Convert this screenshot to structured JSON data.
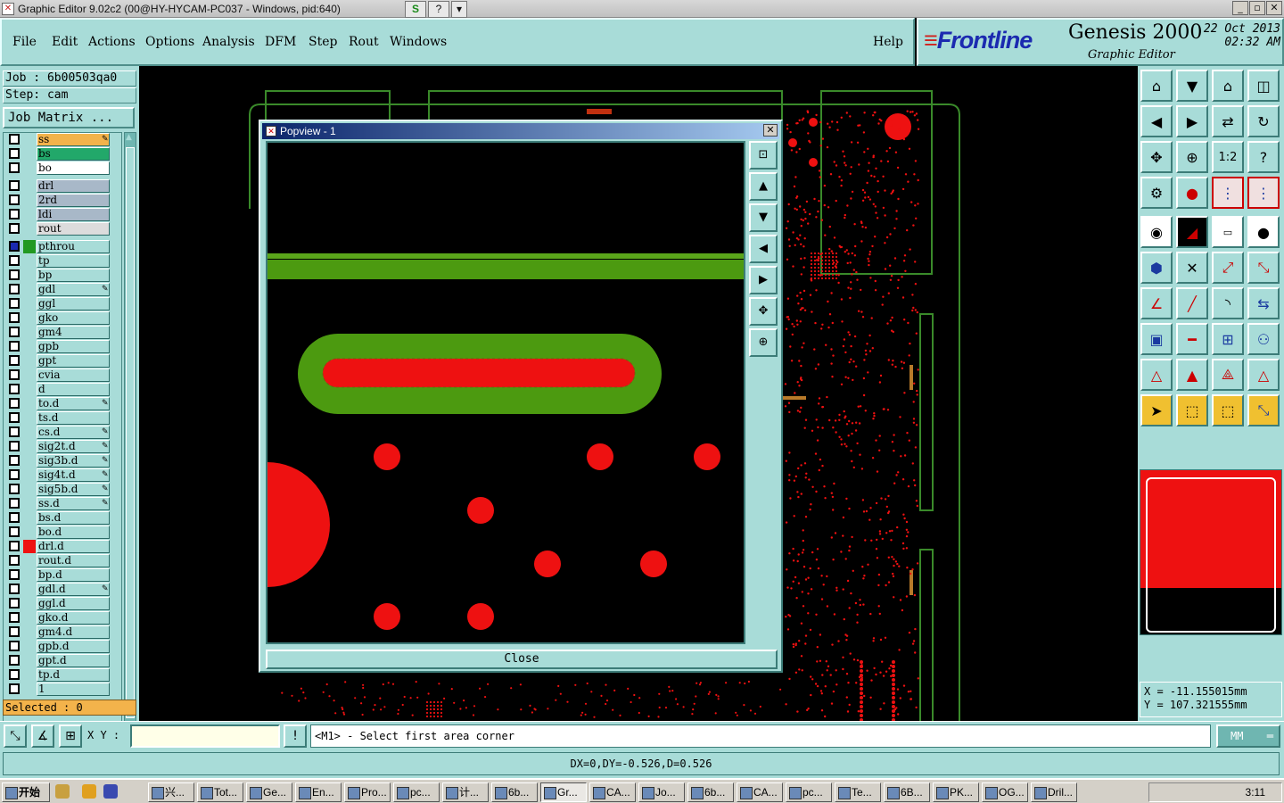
{
  "window": {
    "title": "Graphic Editor 9.02c2 (00@HY-HYCAM-PC037 - Windows, pid:640)",
    "controls": [
      "_",
      "▫",
      "✕"
    ]
  },
  "menu": {
    "items": [
      "File",
      "Edit",
      "Actions",
      "Options",
      "Analysis",
      "DFM",
      "Step",
      "Rout",
      "Windows"
    ],
    "help": "Help"
  },
  "brand": {
    "logo": "Frontline",
    "product": "Genesis 2000",
    "subtitle": "Graphic Editor",
    "date": "22 Oct 2013",
    "time": "02:32 AM"
  },
  "job": {
    "job_line": "Job : 6b00503qa0",
    "step_line": "Step: cam",
    "matrix_button": "Job Matrix ..."
  },
  "layers": [
    {
      "name": "ss",
      "bg": "#f3b34b",
      "edit": true
    },
    {
      "name": "bs",
      "bg": "#22a86a"
    },
    {
      "name": "bo",
      "bg": "#ffffff"
    },
    {
      "name": "drl",
      "bg": "#a8b8c8",
      "gap": true
    },
    {
      "name": "2rd",
      "bg": "#a8b8c8"
    },
    {
      "name": "ldi",
      "bg": "#a8b8c8"
    },
    {
      "name": "rout",
      "bg": "#dcdcdc"
    },
    {
      "name": "pthrou",
      "bg": "#a8dcd8",
      "gap": true,
      "color": "#229922",
      "active": true
    },
    {
      "name": "tp",
      "bg": "#a8dcd8"
    },
    {
      "name": "bp",
      "bg": "#a8dcd8"
    },
    {
      "name": "gdl",
      "bg": "#a8dcd8",
      "edit": true
    },
    {
      "name": "ggl",
      "bg": "#a8dcd8"
    },
    {
      "name": "gko",
      "bg": "#a8dcd8"
    },
    {
      "name": "gm4",
      "bg": "#a8dcd8"
    },
    {
      "name": "gpb",
      "bg": "#a8dcd8"
    },
    {
      "name": "gpt",
      "bg": "#a8dcd8"
    },
    {
      "name": "cvia",
      "bg": "#a8dcd8"
    },
    {
      "name": "d",
      "bg": "#a8dcd8"
    },
    {
      "name": "to.d",
      "bg": "#a8dcd8",
      "edit": true
    },
    {
      "name": "ts.d",
      "bg": "#a8dcd8"
    },
    {
      "name": "cs.d",
      "bg": "#a8dcd8",
      "edit": true
    },
    {
      "name": "sig2t.d",
      "bg": "#a8dcd8",
      "edit": true
    },
    {
      "name": "sig3b.d",
      "bg": "#a8dcd8",
      "edit": true
    },
    {
      "name": "sig4t.d",
      "bg": "#a8dcd8",
      "edit": true
    },
    {
      "name": "sig5b.d",
      "bg": "#a8dcd8",
      "edit": true
    },
    {
      "name": "ss.d",
      "bg": "#a8dcd8",
      "edit": true
    },
    {
      "name": "bs.d",
      "bg": "#a8dcd8"
    },
    {
      "name": "bo.d",
      "bg": "#a8dcd8"
    },
    {
      "name": "drl.d",
      "bg": "#a8dcd8",
      "color": "#ee1111"
    },
    {
      "name": "rout.d",
      "bg": "#a8dcd8"
    },
    {
      "name": "bp.d",
      "bg": "#a8dcd8"
    },
    {
      "name": "gdl.d",
      "bg": "#a8dcd8",
      "edit": true
    },
    {
      "name": "ggl.d",
      "bg": "#a8dcd8"
    },
    {
      "name": "gko.d",
      "bg": "#a8dcd8"
    },
    {
      "name": "gm4.d",
      "bg": "#a8dcd8"
    },
    {
      "name": "gpb.d",
      "bg": "#a8dcd8"
    },
    {
      "name": "gpt.d",
      "bg": "#a8dcd8"
    },
    {
      "name": "tp.d",
      "bg": "#a8dcd8"
    },
    {
      "name": "1",
      "bg": "#a8dcd8"
    }
  ],
  "selected": "Selected : 0",
  "popview": {
    "title": "Popview - 1",
    "close": "Close"
  },
  "coords": {
    "x": "X = -11.155015mm",
    "y": "Y = 107.321555mm"
  },
  "bottom": {
    "xy_label": "X Y :",
    "xy_value": "",
    "prompt": "<M1> - Select first area corner",
    "units": "MM"
  },
  "status": "DX=0,DY=-0.526,D=0.526",
  "taskbar": {
    "start": "开始",
    "tasks": [
      "兴...",
      "Tot...",
      "Ge...",
      "En...",
      "Pro...",
      "pc...",
      "计...",
      "6b...",
      "Gr...",
      "CA...",
      "Jo...",
      "6b...",
      "CA...",
      "pc...",
      "Te...",
      "6B...",
      "PK...",
      "OG...",
      "Dril..."
    ],
    "active_task": "Gr...",
    "clock": "3:11"
  },
  "colors": {
    "panel": "#a8dcd8",
    "feature_red": "#ee1111",
    "feature_green": "#4c9a10",
    "outline_green": "#3a8a2a"
  }
}
